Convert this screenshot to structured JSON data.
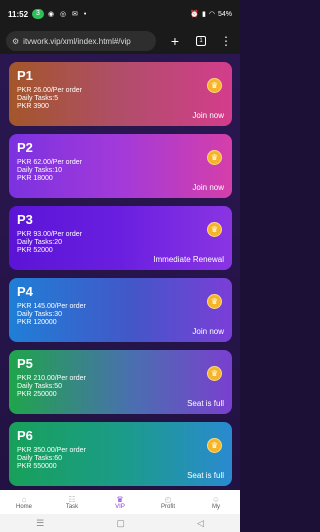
{
  "status": {
    "time": "11:52",
    "badge": "3",
    "battery": "54%"
  },
  "browser": {
    "url": "itvwork.vip/xml/index.html#/vip",
    "tabs_count": "1"
  },
  "cards": [
    {
      "name": "P1",
      "price": "PKR 26.00/Per order",
      "tasks": "Daily Tasks:5",
      "amount": "PKR 3900",
      "action": "Join now"
    },
    {
      "name": "P2",
      "price": "PKR 62.00/Per order",
      "tasks": "Daily Tasks:10",
      "amount": "PKR 18000",
      "action": "Join now"
    },
    {
      "name": "P3",
      "price": "PKR 93.00/Per order",
      "tasks": "Daily Tasks:20",
      "amount": "PKR 52000",
      "action": "Immediate Renewal"
    },
    {
      "name": "P4",
      "price": "PKR 145.00/Per order",
      "tasks": "Daily Tasks:30",
      "amount": "PKR 120000",
      "action": "Join now"
    },
    {
      "name": "P5",
      "price": "PKR 210.00/Per order",
      "tasks": "Daily Tasks:50",
      "amount": "PKR 250000",
      "action": "Seat is full"
    },
    {
      "name": "P6",
      "price": "PKR 350.00/Per order",
      "tasks": "Daily Tasks:60",
      "amount": "PKR 550000",
      "action": "Seat is full"
    }
  ],
  "nav": [
    {
      "label": "Home",
      "icon": "home-icon"
    },
    {
      "label": "Task",
      "icon": "task-icon"
    },
    {
      "label": "VIP",
      "icon": "vip-icon"
    },
    {
      "label": "Profit",
      "icon": "profit-icon"
    },
    {
      "label": "My",
      "icon": "user-icon"
    }
  ],
  "colors": {
    "active_nav": "#8a35e3",
    "coin": "#f5b529"
  }
}
